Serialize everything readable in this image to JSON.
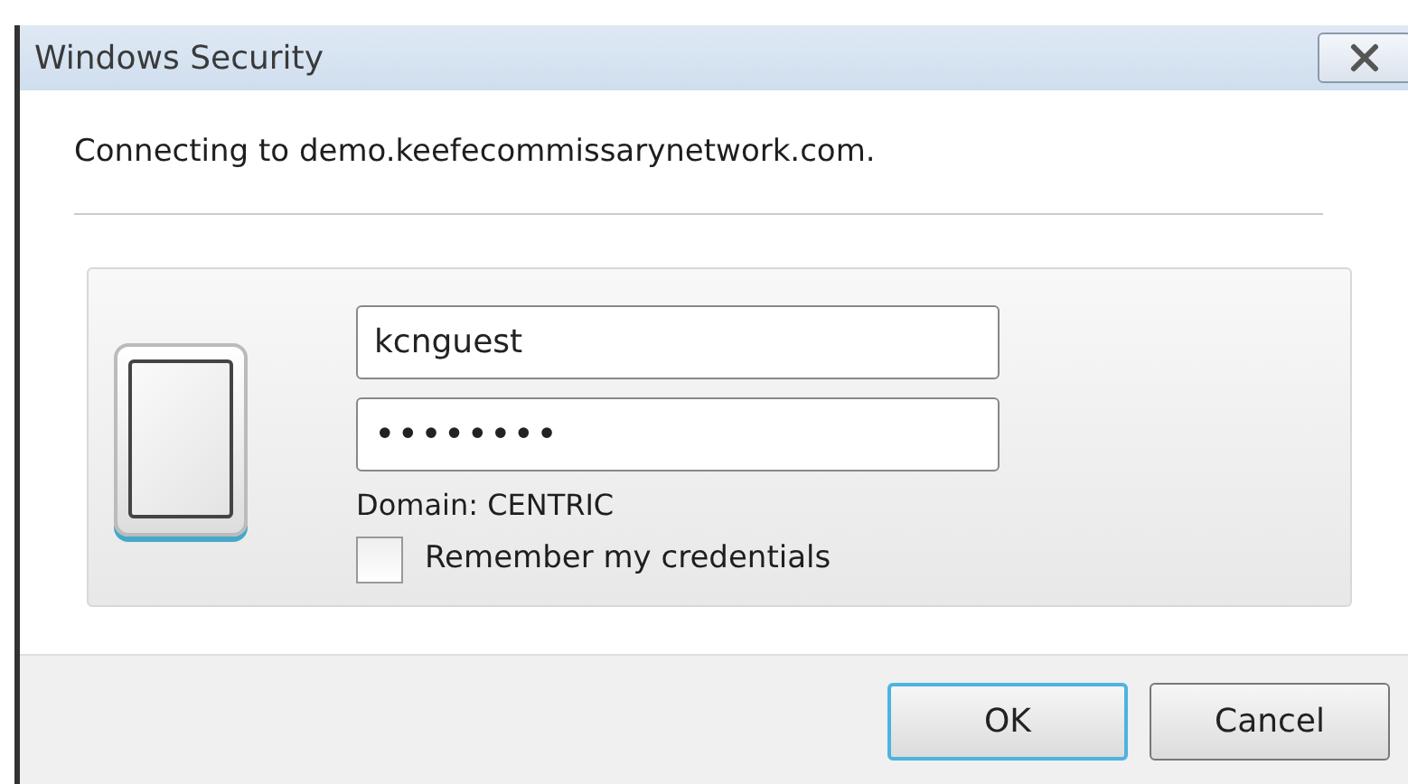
{
  "window": {
    "title": "Windows Security"
  },
  "message": "Connecting to demo.keefecommissarynetwork.com.",
  "credentials": {
    "username": "kcnguest",
    "password": "••••••••",
    "domain": "Domain: CENTRIC",
    "remember": {
      "label": "Remember my credentials",
      "checked": false
    }
  },
  "buttons": [
    {
      "label": "OK",
      "default": true
    },
    {
      "label": "Cancel",
      "default": false
    }
  ]
}
